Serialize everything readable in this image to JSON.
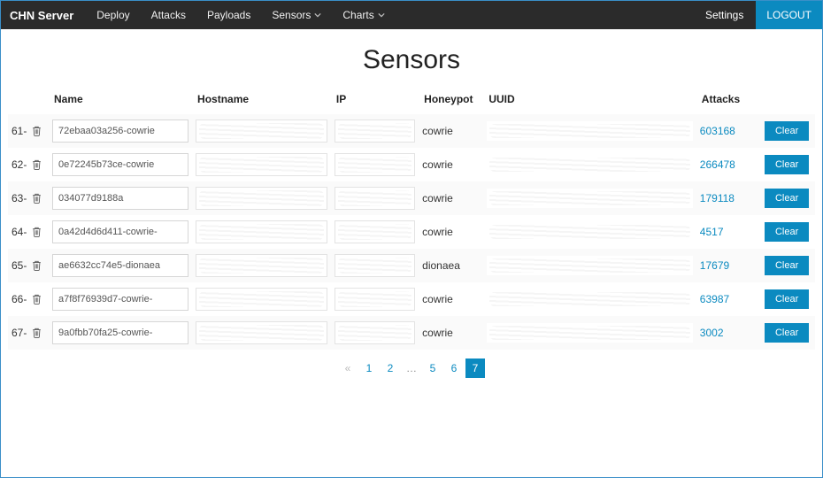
{
  "nav": {
    "brand": "CHN Server",
    "items": [
      "Deploy",
      "Attacks",
      "Payloads",
      "Sensors",
      "Charts"
    ],
    "dropdown_flags": [
      false,
      false,
      false,
      true,
      true
    ],
    "settings": "Settings",
    "logout": "LOGOUT"
  },
  "page": {
    "title": "Sensors"
  },
  "table": {
    "headers": {
      "name": "Name",
      "hostname": "Hostname",
      "ip": "IP",
      "honeypot": "Honeypot",
      "uuid": "UUID",
      "attacks": "Attacks"
    },
    "clear_label": "Clear",
    "rows": [
      {
        "idx": "61-",
        "name": "72ebaa03a256-cowrie",
        "honeypot": "cowrie",
        "attacks": "603168"
      },
      {
        "idx": "62-",
        "name": "0e72245b73ce-cowrie",
        "honeypot": "cowrie",
        "attacks": "266478"
      },
      {
        "idx": "63-",
        "name": "034077d9188a",
        "honeypot": "cowrie",
        "attacks": "179118"
      },
      {
        "idx": "64-",
        "name": "0a42d4d6d411-cowrie-",
        "honeypot": "cowrie",
        "attacks": "4517"
      },
      {
        "idx": "65-",
        "name": "ae6632cc74e5-dionaea",
        "honeypot": "dionaea",
        "attacks": "17679"
      },
      {
        "idx": "66-",
        "name": "a7f8f76939d7-cowrie-",
        "honeypot": "cowrie",
        "attacks": "63987"
      },
      {
        "idx": "67-",
        "name": "9a0fbb70fa25-cowrie-",
        "honeypot": "cowrie",
        "attacks": "3002"
      }
    ]
  },
  "pagination": {
    "prev": "«",
    "pages": [
      "1",
      "2",
      "…",
      "5",
      "6",
      "7"
    ],
    "active": "7"
  }
}
